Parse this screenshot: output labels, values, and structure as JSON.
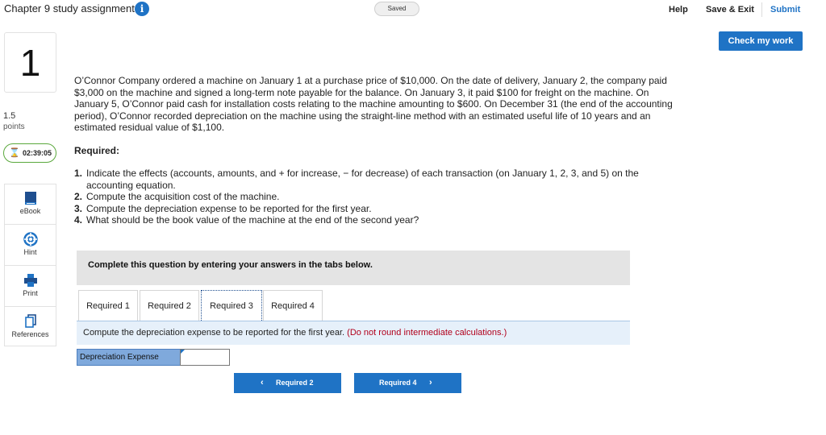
{
  "header": {
    "title": "Chapter 9 study assignment",
    "info_icon": "i",
    "saved": "Saved",
    "help": "Help",
    "save_exit": "Save & Exit",
    "submit": "Submit",
    "check_work": "Check my work"
  },
  "question": {
    "number": "1",
    "points_value": "1.5",
    "points_label": "points",
    "timer": "02:39:05",
    "timer_icon": "hourglass-icon"
  },
  "side_tools": [
    {
      "label": "eBook",
      "icon": "ebook-icon"
    },
    {
      "label": "Hint",
      "icon": "hint-icon"
    },
    {
      "label": "Print",
      "icon": "print-icon"
    },
    {
      "label": "References",
      "icon": "references-icon"
    }
  ],
  "problem": {
    "text": "O’Connor Company ordered a machine on January 1 at a purchase price of $10,000. On the date of delivery, January 2, the company paid $3,000 on the machine and signed a long-term note payable for the balance. On January 3, it paid $100 for freight on the machine. On January 5, O’Connor paid cash for installation costs relating to the machine amounting to $600. On December 31 (the end of the accounting period), O’Connor recorded depreciation on the machine using the straight-line method with an estimated useful life of 10 years and an estimated residual value of $1,100.",
    "required_heading": "Required:",
    "requirements": [
      {
        "num": "1.",
        "text": "Indicate the effects (accounts, amounts, and + for increase, − for decrease) of each transaction (on January 1, 2, 3, and 5) on the accounting equation."
      },
      {
        "num": "2.",
        "text": "Compute the acquisition cost of the machine."
      },
      {
        "num": "3.",
        "text": "Compute the depreciation expense to be reported for the first year."
      },
      {
        "num": "4.",
        "text": "What should be the book value of the machine at the end of the second year?"
      }
    ]
  },
  "answer_area": {
    "instruction": "Complete this question by entering your answers in the tabs below.",
    "tabs": [
      "Required 1",
      "Required 2",
      "Required 3",
      "Required 4"
    ],
    "active_tab": "Required 3",
    "panel_text": "Compute the depreciation expense to be reported for the first year.",
    "panel_note": "(Do not round intermediate calculations.)",
    "field_label": "Depreciation Expense",
    "field_value": "",
    "prev_button": "Required 2",
    "next_button": "Required 4"
  },
  "colors": {
    "accent": "#1f73c5",
    "note_red": "#b1001c",
    "timer_green": "#5aa83c"
  }
}
